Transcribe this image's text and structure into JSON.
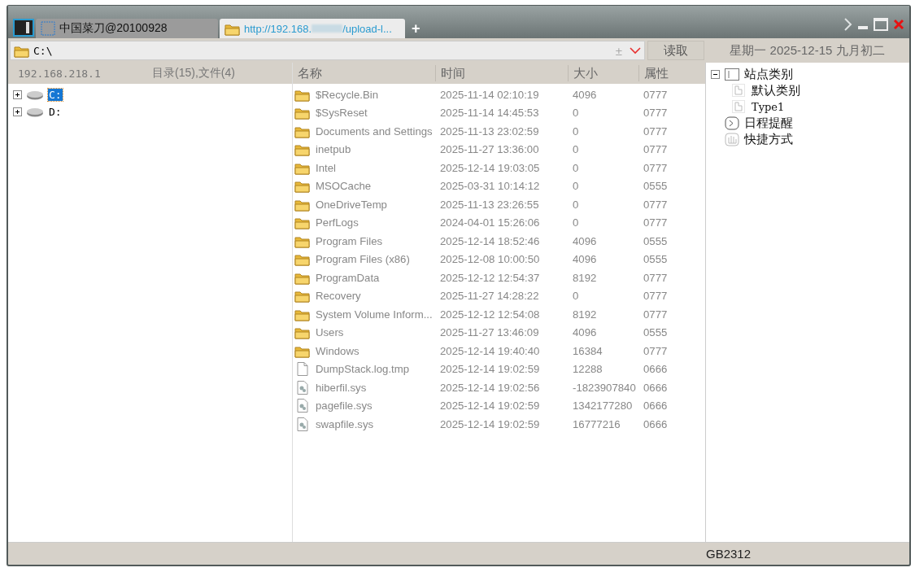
{
  "tabs": [
    {
      "label": "中国菜刀@20100928",
      "selected": false,
      "kind": "home"
    },
    {
      "label_start": "http://192.168.",
      "label_end": "/upload-l...",
      "selected": true,
      "kind": "site"
    }
  ],
  "add_tab": "+",
  "address": {
    "value": "C:\\",
    "history_mark": "±",
    "read_button": "读取"
  },
  "date": "星期一 2025-12-15 九月初二",
  "left_header": {
    "host": "192.168.218.1",
    "counts": "目录(15),文件(4)"
  },
  "drives": [
    {
      "label": "C:",
      "selected": true,
      "expanded": false
    },
    {
      "label": "D:",
      "selected": false,
      "expanded": false
    }
  ],
  "columns": [
    "名称",
    "时间",
    "大小",
    "属性"
  ],
  "rows": [
    {
      "kind": "folder",
      "name": "$Recycle.Bin",
      "time": "2025-11-14 02:10:19",
      "size": "4096",
      "attr": "0777"
    },
    {
      "kind": "folder",
      "name": "$SysReset",
      "time": "2025-11-14 14:45:53",
      "size": "0",
      "attr": "0777"
    },
    {
      "kind": "folder",
      "name": "Documents and Settings",
      "time": "2025-11-13 23:02:59",
      "size": "0",
      "attr": "0777"
    },
    {
      "kind": "folder",
      "name": "inetpub",
      "time": "2025-11-27 13:36:00",
      "size": "0",
      "attr": "0777"
    },
    {
      "kind": "folder",
      "name": "Intel",
      "time": "2025-12-14 19:03:05",
      "size": "0",
      "attr": "0777"
    },
    {
      "kind": "folder",
      "name": "MSOCache",
      "time": "2025-03-31 10:14:12",
      "size": "0",
      "attr": "0555"
    },
    {
      "kind": "folder",
      "name": "OneDriveTemp",
      "time": "2025-11-13 23:26:55",
      "size": "0",
      "attr": "0777"
    },
    {
      "kind": "folder",
      "name": "PerfLogs",
      "time": "2024-04-01 15:26:06",
      "size": "0",
      "attr": "0777"
    },
    {
      "kind": "folder",
      "name": "Program Files",
      "time": "2025-12-14 18:52:46",
      "size": "4096",
      "attr": "0555"
    },
    {
      "kind": "folder",
      "name": "Program Files (x86)",
      "time": "2025-12-08 10:00:50",
      "size": "4096",
      "attr": "0555"
    },
    {
      "kind": "folder",
      "name": "ProgramData",
      "time": "2025-12-12 12:54:37",
      "size": "8192",
      "attr": "0777"
    },
    {
      "kind": "folder",
      "name": "Recovery",
      "time": "2025-11-27 14:28:22",
      "size": "0",
      "attr": "0777"
    },
    {
      "kind": "folder",
      "name": "System Volume Inform...",
      "time": "2025-12-12 12:54:08",
      "size": "8192",
      "attr": "0777"
    },
    {
      "kind": "folder",
      "name": "Users",
      "time": "2025-11-27 13:46:09",
      "size": "4096",
      "attr": "0555"
    },
    {
      "kind": "folder",
      "name": "Windows",
      "time": "2025-12-14 19:40:40",
      "size": "16384",
      "attr": "0777"
    },
    {
      "kind": "file",
      "name": "DumpStack.log.tmp",
      "time": "2025-12-14 19:02:59",
      "size": "12288",
      "attr": "0666"
    },
    {
      "kind": "system",
      "name": "hiberfil.sys",
      "time": "2025-12-14 19:02:56",
      "size": "-1823907840",
      "attr": "0666"
    },
    {
      "kind": "system",
      "name": "pagefile.sys",
      "time": "2025-12-14 19:02:59",
      "size": "1342177280",
      "attr": "0666"
    },
    {
      "kind": "system",
      "name": "swapfile.sys",
      "time": "2025-12-14 19:02:59",
      "size": "16777216",
      "attr": "0666"
    }
  ],
  "site_tree": [
    {
      "label": "站点类别",
      "kind": "category",
      "expanded": true,
      "children": [
        {
          "label": "默认类别",
          "kind": "page"
        },
        {
          "label": "Type1",
          "kind": "page"
        }
      ]
    },
    {
      "label": "日程提醒",
      "kind": "schedule"
    },
    {
      "label": "快捷方式",
      "kind": "shortcut"
    }
  ],
  "status_bar": {
    "encoding": "GB2312"
  }
}
